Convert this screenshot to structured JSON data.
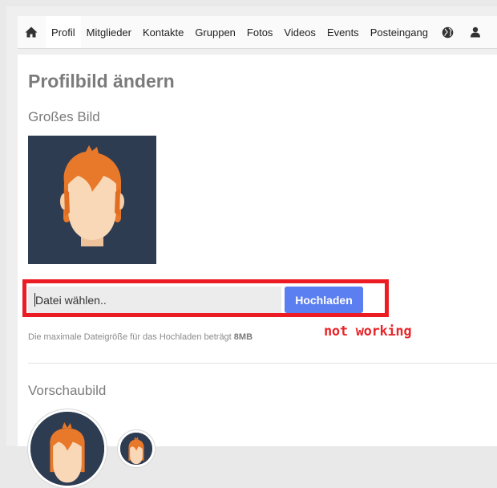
{
  "nav": {
    "items": [
      {
        "label": "Profil"
      },
      {
        "label": "Mitglieder"
      },
      {
        "label": "Kontakte"
      },
      {
        "label": "Gruppen"
      },
      {
        "label": "Fotos"
      },
      {
        "label": "Videos"
      },
      {
        "label": "Events"
      },
      {
        "label": "Posteingang"
      }
    ],
    "home_icon": "home-icon",
    "globe_icon": "globe-icon",
    "user_icon": "user-icon"
  },
  "page": {
    "title": "Profilbild ändern",
    "large_heading": "Großes Bild",
    "preview_heading": "Vorschaubild"
  },
  "upload": {
    "file_placeholder": "Datei wählen..",
    "button_label": "Hochladen",
    "hint_text": "Die maximale Dateigröße für das Hochladen beträgt ",
    "hint_size": "8MB"
  },
  "annotation": {
    "text": "not working",
    "color": "#ec1c24"
  },
  "colors": {
    "accent": "#5b7ff0",
    "avatar_bg": "#2e3c52",
    "hair": "#e8782a"
  }
}
